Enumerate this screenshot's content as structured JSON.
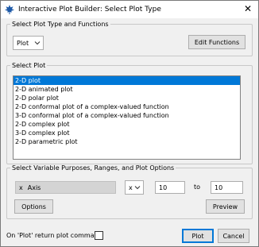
{
  "window": {
    "title": "Interactive Plot Builder: Select Plot Type",
    "close_glyph": "✕"
  },
  "plot_type_group": {
    "legend": "Select Plot Type and Functions",
    "combo_value": "Plot",
    "edit_functions_label": "Edit Functions"
  },
  "select_plot_group": {
    "legend": "Select Plot",
    "items": [
      "2-D plot",
      "2-D animated plot",
      "2-D polar plot",
      "2-D conformal plot of a complex-valued function",
      "3-D conformal plot of a complex-valued function",
      "2-D complex plot",
      "3-D complex plot",
      "2-D parametric plot"
    ],
    "selected_index": 0
  },
  "options_group": {
    "legend": "Select Variable Purposes, Ranges, and Plot Options",
    "variable_label": "x",
    "variable_purpose": "Axis",
    "axis_combo_value": "x",
    "range_from": "10",
    "range_to_label": "to",
    "range_to": "10",
    "options_label": "Options",
    "preview_label": "Preview"
  },
  "footer": {
    "return_label": "On 'Plot' return plot command",
    "return_checked": false,
    "plot_label": "Plot",
    "cancel_label": "Cancel"
  },
  "colors": {
    "selection": "#0078d7",
    "default_button_border": "#0078d7"
  }
}
